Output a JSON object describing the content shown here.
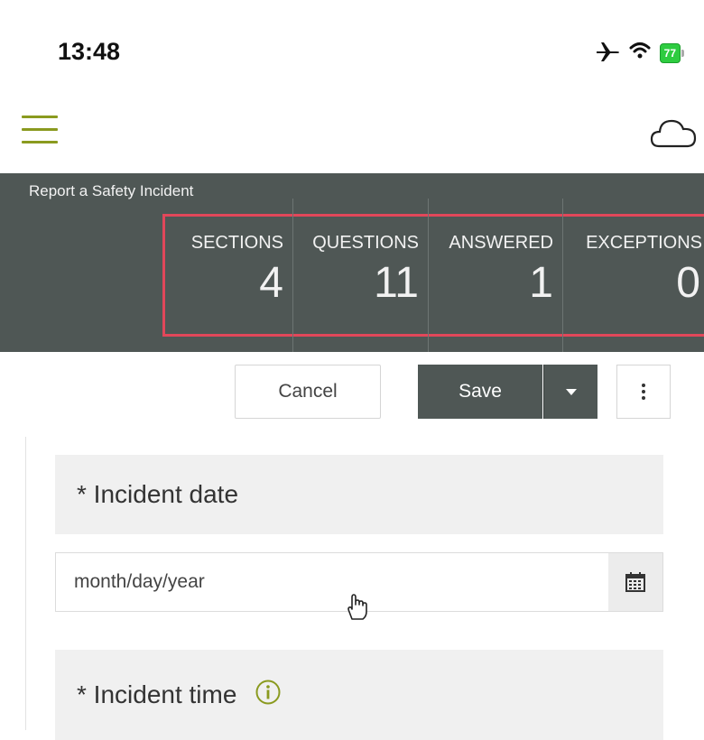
{
  "status_bar": {
    "time": "13:48",
    "battery": "77"
  },
  "app_header": {
    "menu_icon": "hamburger-icon",
    "sync_icon": "cloud-icon"
  },
  "summary": {
    "form_title": "Report a Safety Incident",
    "stats": [
      {
        "label": "SECTIONS",
        "value": "4"
      },
      {
        "label": "QUESTIONS",
        "value": "11"
      },
      {
        "label": "ANSWERED",
        "value": "1"
      },
      {
        "label": "EXCEPTIONS",
        "value": "0"
      }
    ],
    "highlight_color": "#e2475a",
    "band_color": "#4f5755"
  },
  "toolbar": {
    "cancel_label": "Cancel",
    "save_label": "Save"
  },
  "form": {
    "question1_label": "* Incident date",
    "date_placeholder": "month/day/year",
    "question2_label": "* Incident time"
  },
  "colors": {
    "accent_green": "#8a9a1f"
  }
}
